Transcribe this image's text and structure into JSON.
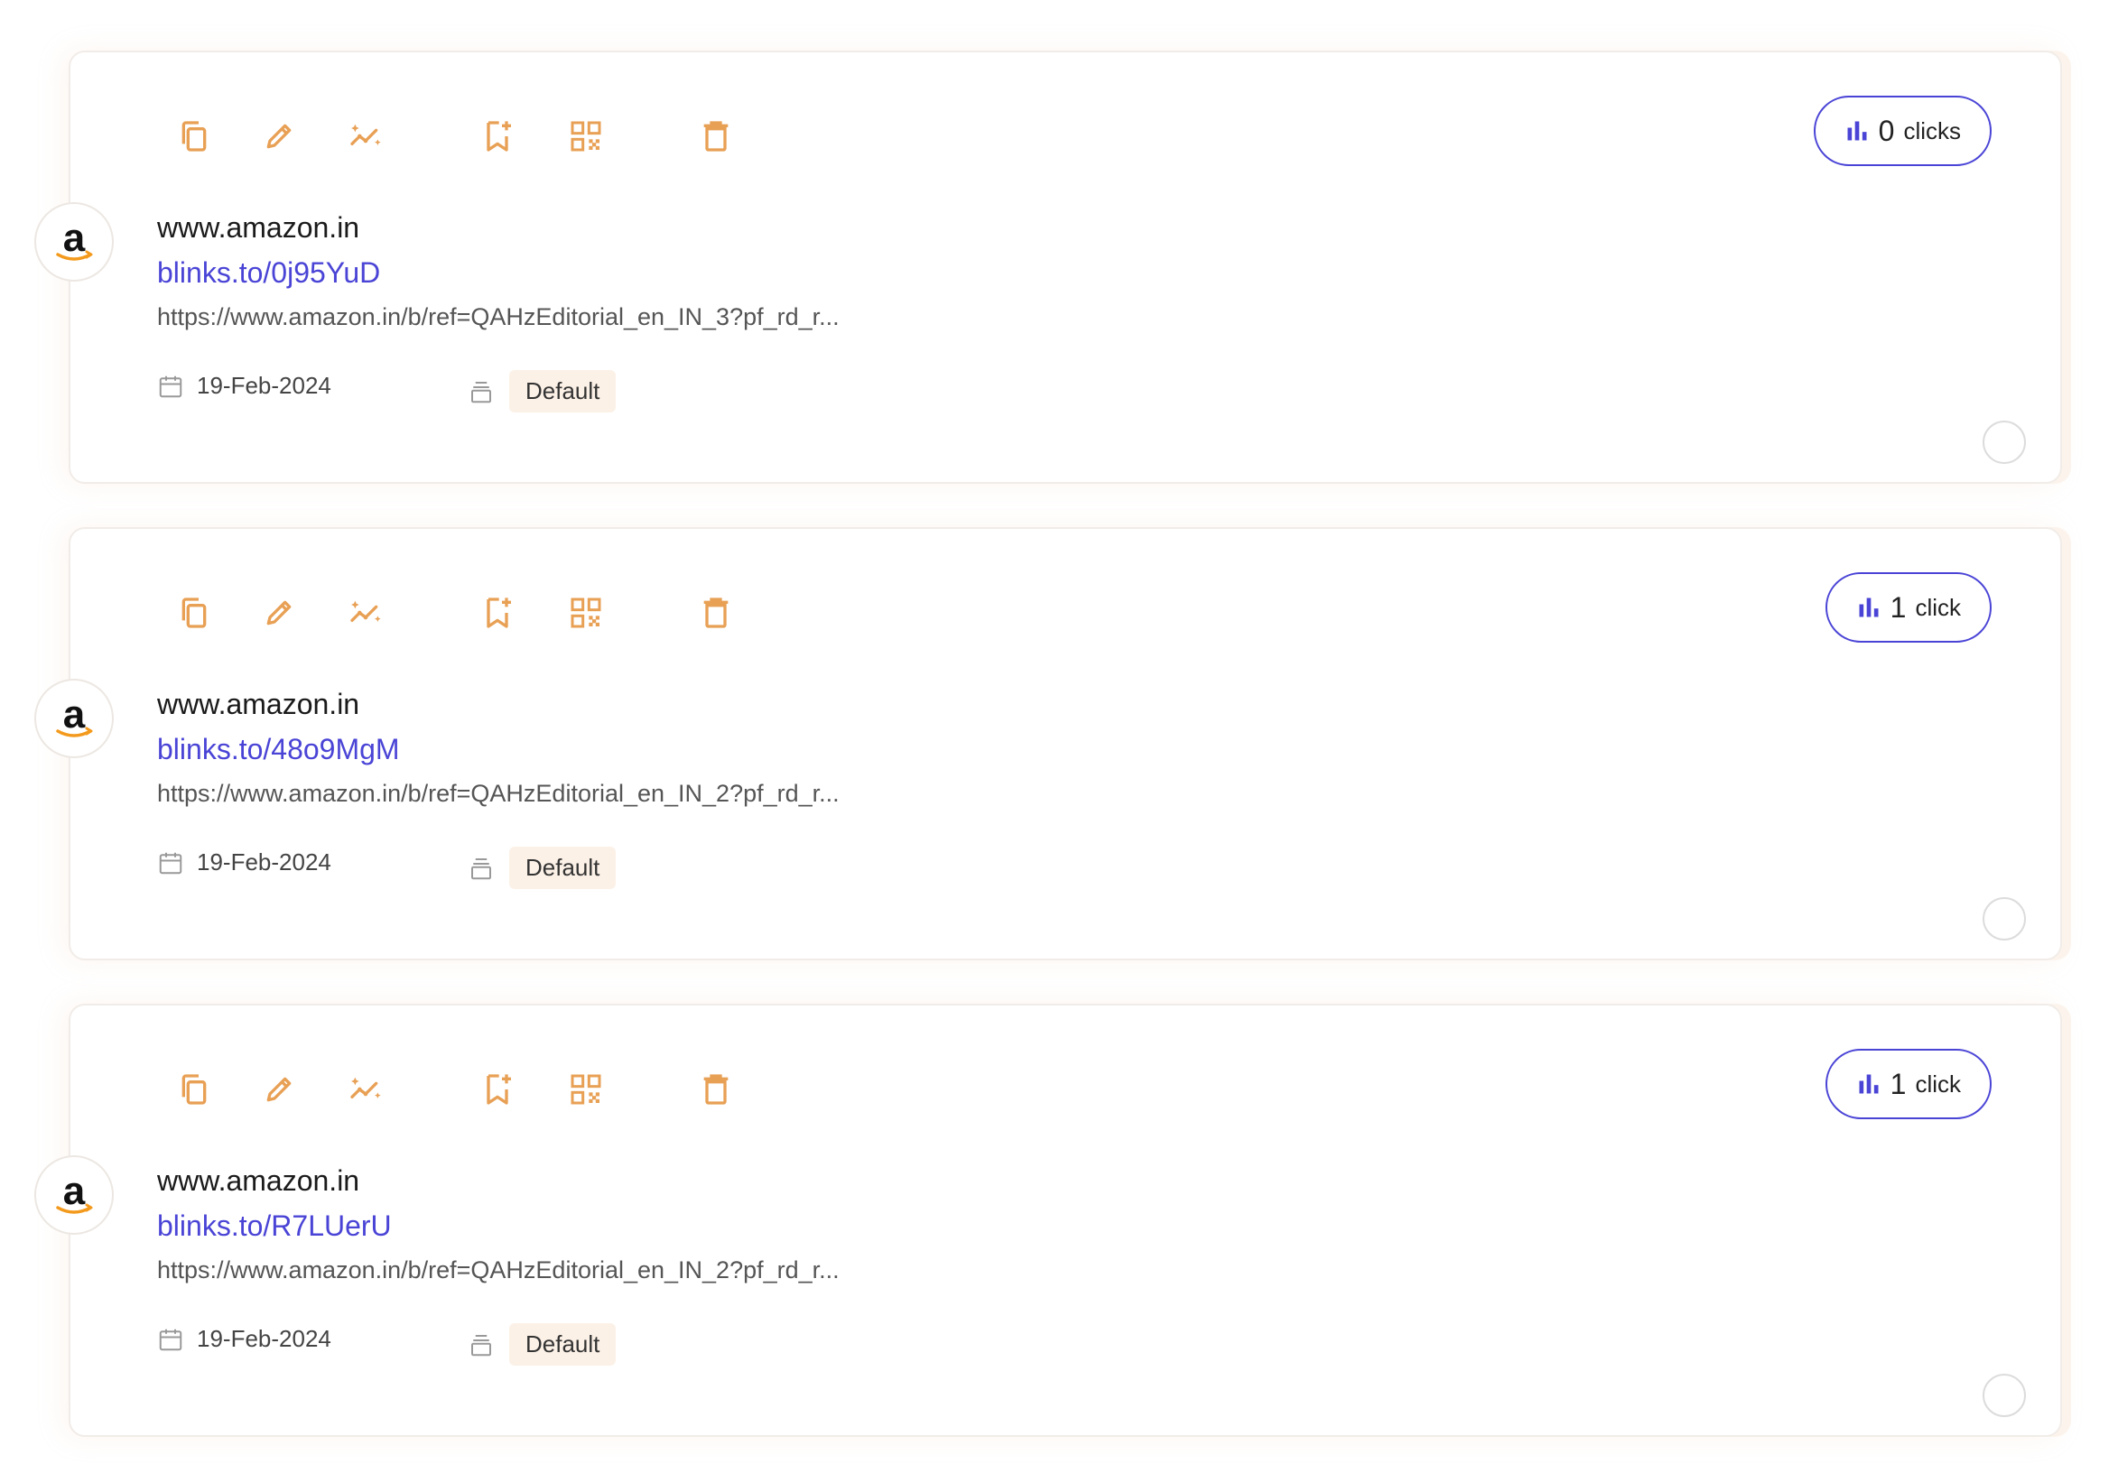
{
  "colors": {
    "accent_orange": "#e8a055",
    "link_blue": "#4a44d6",
    "tag_bg": "#fcf1e7"
  },
  "toolbar_icons": [
    "copy-icon",
    "edit-icon",
    "analytics-sparkle-icon",
    "bookmark-add-icon",
    "qr-code-icon",
    "delete-icon"
  ],
  "links": [
    {
      "clicks_count": "0",
      "clicks_word": "clicks",
      "domain": "www.amazon.in",
      "short_url": "blinks.to/0j95YuD",
      "long_url": "https://www.amazon.in/b/ref=QAHzEditorial_en_IN_3?pf_rd_r...",
      "date": "19-Feb-2024",
      "tag": "Default",
      "favicon": "amazon-logo"
    },
    {
      "clicks_count": "1",
      "clicks_word": "click",
      "domain": "www.amazon.in",
      "short_url": "blinks.to/48o9MgM",
      "long_url": "https://www.amazon.in/b/ref=QAHzEditorial_en_IN_2?pf_rd_r...",
      "date": "19-Feb-2024",
      "tag": "Default",
      "favicon": "amazon-logo"
    },
    {
      "clicks_count": "1",
      "clicks_word": "click",
      "domain": "www.amazon.in",
      "short_url": "blinks.to/R7LUerU",
      "long_url": "https://www.amazon.in/b/ref=QAHzEditorial_en_IN_2?pf_rd_r...",
      "date": "19-Feb-2024",
      "tag": "Default",
      "favicon": "amazon-logo"
    }
  ]
}
